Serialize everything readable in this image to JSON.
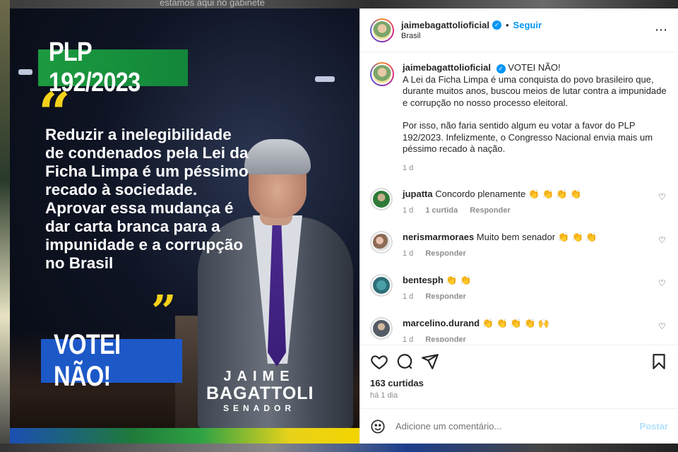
{
  "background": {
    "top_text": "estamos aqui no gabinete"
  },
  "media": {
    "badge_top": "PLP 192/2023",
    "quote_open": "“",
    "quote_close": "”",
    "quote": "Reduzir a inelegibilidade de condenados pela Lei da Ficha Limpa é um péssimo recado à sociedade. Aprovar essa mudança é dar carta branca para a impunidade e a corrupção no Brasil",
    "badge_bottom": "VOTEI NÃO!",
    "signature_first": "JAIME",
    "signature_last": "BAGATTOLI",
    "signature_role": "SENADOR",
    "colors": {
      "green": "#1c9a40",
      "yellow": "#f5d21a",
      "blue": "#1d58c7"
    }
  },
  "header": {
    "username": "jaimebagattolioficial",
    "separator": "•",
    "follow_label": "Seguir",
    "location": "Brasil",
    "more_icon": "⋯"
  },
  "caption": {
    "username": "jaimebagattolioficial",
    "line1": "VOTEI NÃO!",
    "para1": "A Lei da Ficha Limpa é uma conquista do povo brasileiro que, durante muitos anos, buscou meios de lutar contra a impunidade e corrupção no nosso processo eleitoral.",
    "para2": "Por isso, não faria sentido algum eu votar a favor do PLP 192/2023. Infelizmente, o Congresso Nacional envia mais um péssimo recado à nação.",
    "time": "1 d"
  },
  "comments": [
    {
      "username": "jupatta",
      "text": "Concordo plenamente 👏 👏 👏 👏",
      "time": "1 d",
      "likes": "1 curtida",
      "reply": "Responder"
    },
    {
      "username": "nerismarmoraes",
      "text": "Muito bem senador 👏 👏 👏",
      "time": "1 d",
      "reply": "Responder"
    },
    {
      "username": "bentesph",
      "text": "👏 👏",
      "time": "1 d",
      "reply": "Responder"
    },
    {
      "username": "marcelino.durand",
      "text": "👏 👏 👏 👏 🙌",
      "time": "1 d",
      "reply": "Responder"
    }
  ],
  "actions": {
    "likes": "163 curtidas",
    "posted": "há 1 dia"
  },
  "add_comment": {
    "placeholder": "Adicione um comentário...",
    "post_label": "Postar"
  },
  "colors": {
    "accent": "#0095f6",
    "post_disabled": "#b2dffc"
  }
}
